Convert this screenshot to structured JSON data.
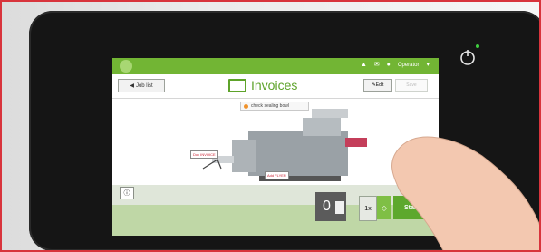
{
  "topbar": {
    "operator_label": "Operator"
  },
  "subbar": {
    "back_label": "Job list",
    "title": "Invoices",
    "edit_label": "Edit",
    "save_label": "Save"
  },
  "alert": {
    "text": "check sealing bowl"
  },
  "machine_tags": {
    "tray_left": "Doc\nINVOICE",
    "tray_right": "Add\nFLYER",
    "output": "2"
  },
  "controls": {
    "counter_value": "0",
    "multiplier_label": "1x",
    "start_label": "Start",
    "info_icon": "info-icon",
    "play_icon": "play-icon"
  },
  "colors": {
    "brand_green": "#72b534",
    "start_green": "#5da82d",
    "screen_bg": "#ffffff"
  }
}
